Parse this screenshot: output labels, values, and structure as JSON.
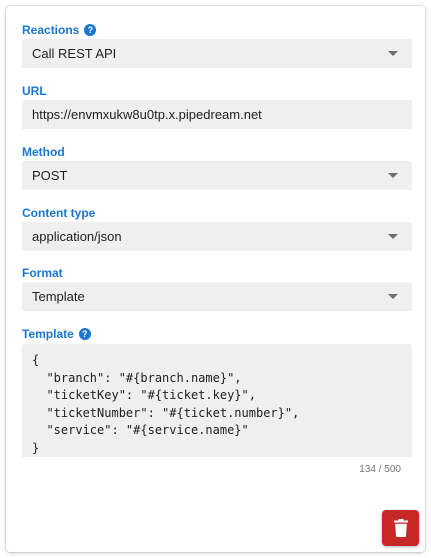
{
  "reactions": {
    "label": "Reactions",
    "value": "Call REST API"
  },
  "url": {
    "label": "URL",
    "value": "https://envmxukw8u0tp.x.pipedream.net"
  },
  "method": {
    "label": "Method",
    "value": "POST"
  },
  "content_type": {
    "label": "Content type",
    "value": "application/json"
  },
  "format": {
    "label": "Format",
    "value": "Template"
  },
  "template": {
    "label": "Template",
    "value": "{\n  \"branch\": \"#{branch.name}\",\n  \"ticketKey\": \"#{ticket.key}\",\n  \"ticketNumber\": \"#{ticket.number}\",\n  \"service\": \"#{service.name}\"\n}",
    "counter": "134 / 500"
  },
  "icons": {
    "help": "help-circle-icon",
    "dropdown": "caret-down-icon",
    "delete": "trash-icon"
  },
  "colors": {
    "label_accent": "#1976d2",
    "delete_button": "#c62828",
    "field_background": "#efefef"
  }
}
